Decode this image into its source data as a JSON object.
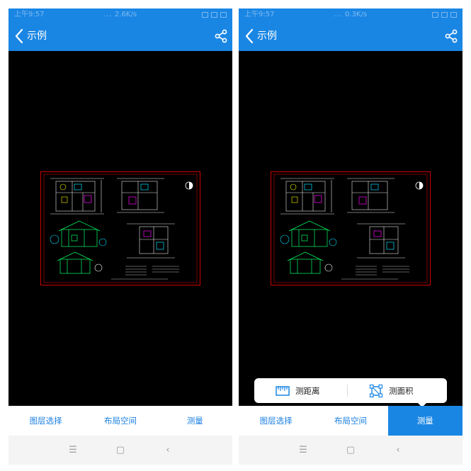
{
  "status": {
    "time": "上午9:57",
    "dots": "...",
    "left_speed": "2.6K/s",
    "right_speed": "0.3K/s"
  },
  "appbar": {
    "title": "示例",
    "back_icon": "chevron-left-icon",
    "share_icon": "share-icon"
  },
  "tabs": [
    {
      "label": "图层选择"
    },
    {
      "label": "布局空间"
    },
    {
      "label": "测量"
    }
  ],
  "measure_menu": {
    "distance_label": "测距离",
    "area_label": "测面积",
    "distance_icon": "ruler-icon",
    "area_icon": "area-icon"
  },
  "colors": {
    "brand": "#1a86e4",
    "canvas": "#000000",
    "frame": "#cc0000"
  }
}
